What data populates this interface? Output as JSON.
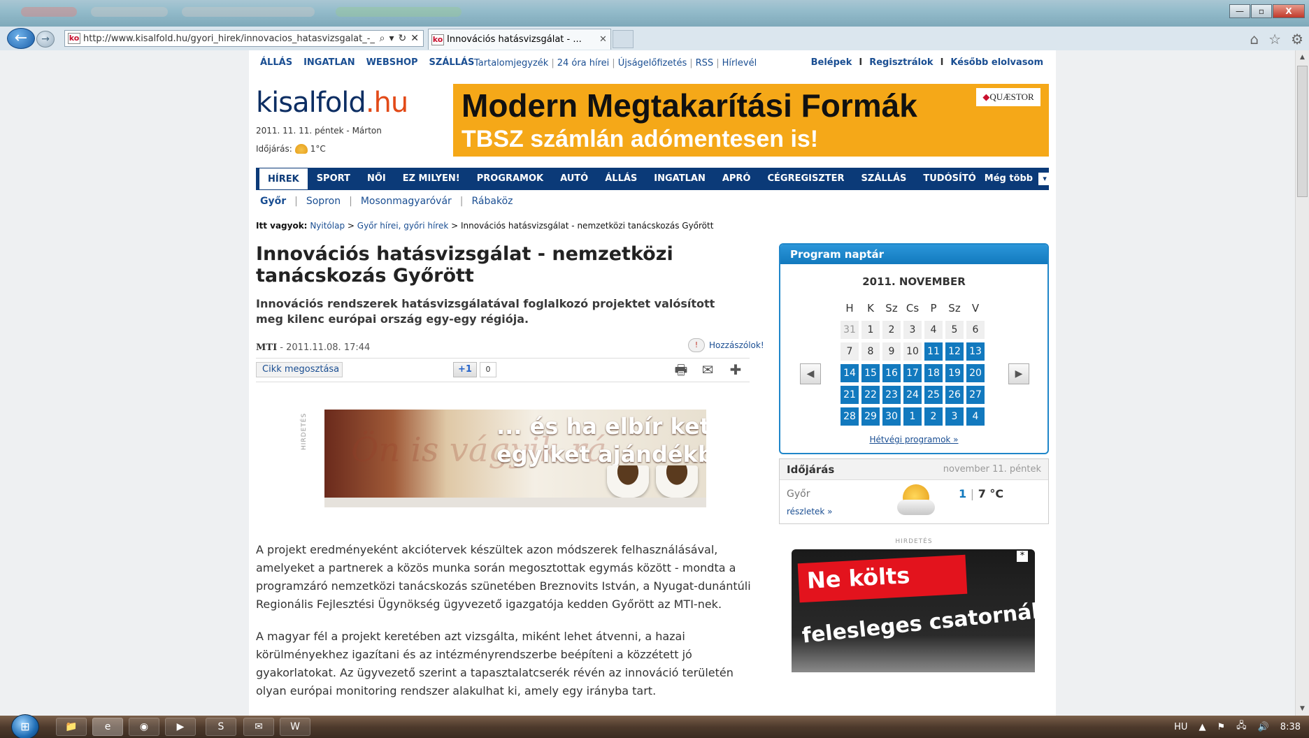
{
  "browser": {
    "address": "http://www.kisalfold.hu/gyori_hirek/innovacios_hatasvizsgalat_-_",
    "favicon": "ko",
    "tab_title": "Innovációs hatásvizsgálat - ...",
    "tab_close": "✕",
    "back_icon": "←",
    "forward_icon": "→",
    "addr_icons": [
      "⌕",
      "▾",
      "↻",
      "✕"
    ],
    "right_tools": [
      "⌂",
      "☆",
      "⚙"
    ],
    "win_controls": [
      "—",
      "▫",
      "X"
    ]
  },
  "toplinks": {
    "main": [
      "ÁLLÁS",
      "INGATLAN",
      "WEBSHOP",
      "SZÁLLÁS"
    ],
    "mid": [
      "Tartalomjegyzék",
      "24 óra hírei",
      "Újságelőfizetés",
      "RSS",
      "Hírlevél"
    ],
    "right": [
      "Belépek",
      "Regisztrálok",
      "Később elolvasom"
    ]
  },
  "logo": {
    "main": "kisalfold",
    "tld": ".hu"
  },
  "date_line": "2011. 11. 11. péntek - Márton",
  "weather_line": {
    "label": "Időjárás:",
    "temp": "1°C"
  },
  "banner": {
    "headline": "Modern Megtakarítási Formák",
    "subline": "TBSZ számlán adómentesen is!",
    "brand": "QUÆSTOR"
  },
  "mainnav": {
    "items": [
      "HÍREK",
      "SPORT",
      "NŐI",
      "EZ MILYEN!",
      "PROGRAMOK",
      "AUTÓ",
      "ÁLLÁS",
      "INGATLAN",
      "APRÓ",
      "CÉGREGISZTER",
      "SZÁLLÁS",
      "TUDÓSÍTÓ"
    ],
    "more": "Még több",
    "more_icon": "▾"
  },
  "subnav": [
    "Győr",
    "Sopron",
    "Mosonmagyaróvár",
    "Rábaköz"
  ],
  "breadcrumb": {
    "label": "Itt vagyok:",
    "items": [
      "Nyitólap",
      "Győr hírei, győri hírek",
      "Innovációs hatásvizsgálat - nemzetközi tanácskozás Győrött"
    ]
  },
  "article": {
    "title": "Innovációs hatásvizsgálat - nemzetközi tanácskozás Győrött",
    "lead": "Innovációs rendszerek hatásvizsgálatával foglalkozó projektet valósított meg kilenc európai ország egy-egy régiója.",
    "source": "MTI",
    "date": "2011.11.08. 17:44",
    "comments": "Hozzászólok!",
    "share": "Cikk megosztása",
    "plusone": "+1",
    "plusone_count": "0",
    "ad_label": "HIRDETÉS",
    "ad_ghost": "Ön is vágyik rá",
    "ad_text_1": "... és ha elbír kettőve",
    "ad_text_2": "egyiket ajándékba a",
    "para1": "A projekt eredményeként akciótervek készültek azon módszerek felhasználásával, amelyeket a partnerek a közös munka során megosztottak egymás között - mondta a programzáró nemzetközi tanácskozás szünetében Breznovits István, a Nyugat-dunántúli Regionális Fejlesztési Ügynökség ügyvezető igazgatója kedden Győrött az MTI-nek.",
    "para2": "A magyar fél a projekt keretében azt vizsgálta, miként lehet átvenni, a hazai körülményekhez igazítani és az intézményrendszerbe beépíteni a közzétett jó gyakorlatokat. Az ügyvezető szerint a tapasztalatcserék révén az innováció területén olyan európai monitoring rendszer alakulhat ki, amely egy irányba tart."
  },
  "calendar": {
    "header": "Program naptár",
    "month": "2011. NOVEMBER",
    "weekdays": [
      "H",
      "K",
      "Sz",
      "Cs",
      "P",
      "Sz",
      "V"
    ],
    "weeks": [
      [
        "31",
        "1",
        "2",
        "3",
        "4",
        "5",
        "6"
      ],
      [
        "7",
        "8",
        "9",
        "10",
        "11",
        "12",
        "13"
      ],
      [
        "14",
        "15",
        "16",
        "17",
        "18",
        "19",
        "20"
      ],
      [
        "21",
        "22",
        "23",
        "24",
        "25",
        "26",
        "27"
      ],
      [
        "28",
        "29",
        "30",
        "1",
        "2",
        "3",
        "4"
      ]
    ],
    "weekend_link": "Hétvégi programok »",
    "prev_icon": "◀",
    "next_icon": "▶"
  },
  "weather": {
    "title": "Időjárás",
    "date": "november 11. péntek",
    "city": "Győr",
    "details": "részletek »",
    "min": "1",
    "sep": "|",
    "max": "7 °C"
  },
  "side_ad": {
    "label": "HIRDETÉS",
    "line1": "Ne költs",
    "line2": "felesleges csatornákra!",
    "star": "*"
  },
  "taskbar": {
    "apps": [
      "📁",
      "e",
      "◉",
      "▶",
      "S",
      "✉",
      "W"
    ],
    "lang": "HU",
    "tray": [
      "▲",
      "⚑",
      "🖧",
      "🔊"
    ],
    "time": "8:38"
  },
  "colors": {
    "accent_blue": "#1279be",
    "nav_blue": "#0b3a78",
    "logo_orange": "#e24a18",
    "banner_orange": "#f5a818",
    "ad_red": "#e3131d"
  }
}
